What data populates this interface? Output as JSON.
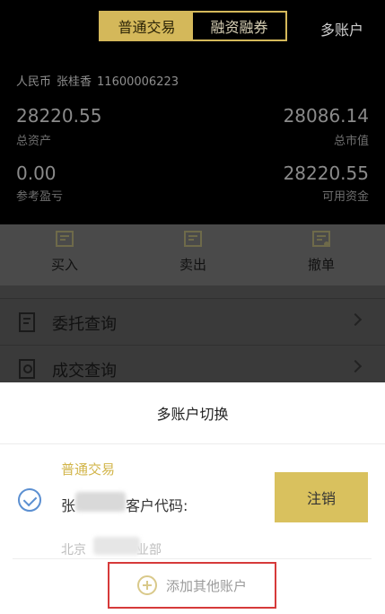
{
  "header": {
    "tabs": [
      {
        "label": "普通交易",
        "active": true
      },
      {
        "label": "融资融券",
        "active": false
      }
    ],
    "multi_account_label": "多账户"
  },
  "account": {
    "currency": "人民币",
    "holder": "张桂香",
    "account_no": "11600006223"
  },
  "summary": {
    "total_assets_value": "28220.55",
    "total_assets_label": "总资产",
    "market_value": "28086.14",
    "market_value_label": "总市值",
    "ref_pnl_value": "0.00",
    "ref_pnl_label": "参考盈亏",
    "available_value": "28220.55",
    "available_label": "可用资金"
  },
  "actions": [
    {
      "label": "买入",
      "icon": "buy-icon"
    },
    {
      "label": "卖出",
      "icon": "sell-icon"
    },
    {
      "label": "撤单",
      "icon": "cancel-order-icon"
    }
  ],
  "menu": [
    {
      "label": "委托查询",
      "icon": "order-query-icon"
    },
    {
      "label": "成交查询",
      "icon": "trade-query-icon"
    }
  ],
  "sheet": {
    "title": "多账户切换",
    "account_type": "普通交易",
    "name_prefix": "张",
    "customer_code_label": "客户代码:",
    "branch_prefix": "北京",
    "branch_suffix": "业部",
    "logout_label": "注销",
    "add_label": "添加其他账户"
  },
  "colors": {
    "accent": "#d4b85a",
    "highlight_border": "#d63a3a",
    "check": "#5b8fd1"
  }
}
